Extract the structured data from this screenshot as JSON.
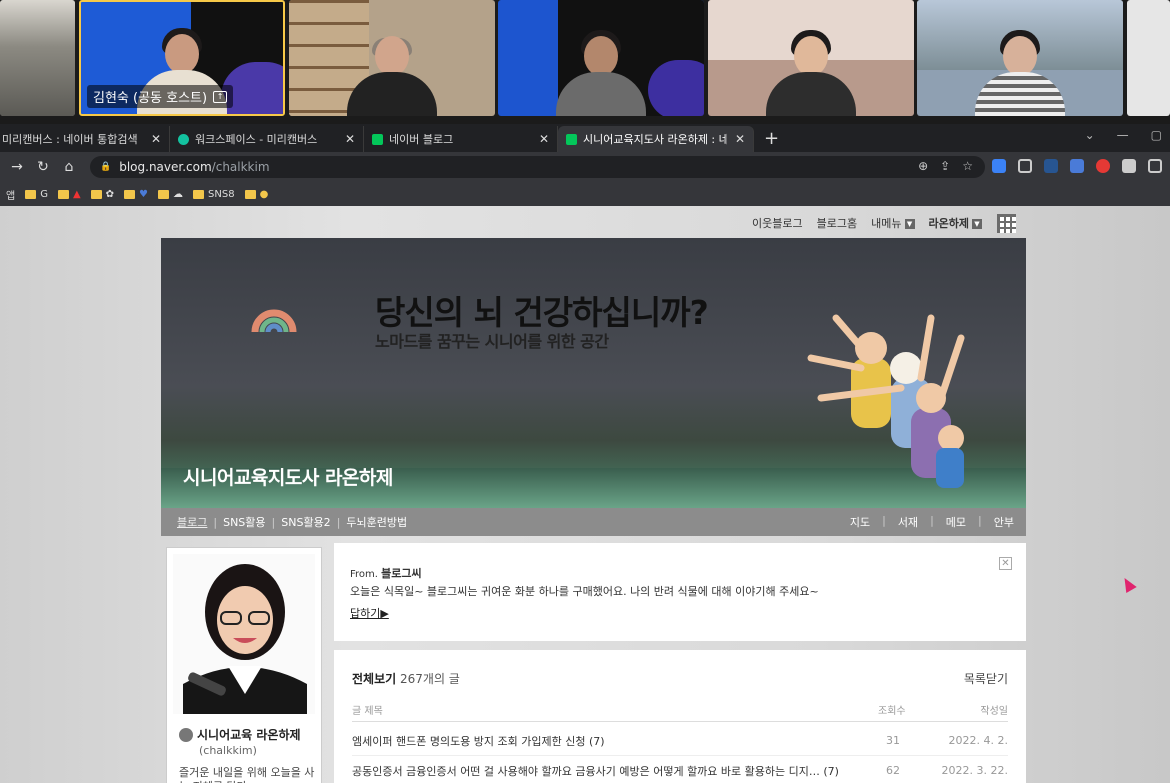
{
  "video_call": {
    "tiles": [
      {
        "name": "",
        "bg": "#8b8a86"
      },
      {
        "name": "김현숙 (공동 호스트)",
        "bg": "#1e5bd6",
        "active": true
      },
      {
        "name": "",
        "bg": "#b4a28a"
      },
      {
        "name": "",
        "bg": "#1d55cf"
      },
      {
        "name": "",
        "bg": "#b89a8c"
      },
      {
        "name": "",
        "bg": "#8fa0b2"
      },
      {
        "name": "",
        "bg": "#e6e6e6"
      }
    ],
    "host_label": "김현숙 (공동 호스트)"
  },
  "browser": {
    "tabs": [
      {
        "title": "미리캔버스 : 네이버 통합검색",
        "fav_color": "#03c75a",
        "active": false
      },
      {
        "title": "워크스페이스 - 미리캔버스",
        "fav_color": "#13c2a0",
        "active": false
      },
      {
        "title": "네이버 블로그",
        "fav_color": "#03c75a",
        "active": false
      },
      {
        "title": "시니어교육지도사 라온하제 : 네",
        "fav_color": "#03c75a",
        "active": true
      }
    ],
    "new_tab": "+",
    "url_host": "blog.naver.com",
    "url_path": "/chalkkim",
    "bookmarks": [
      {
        "label": "앱",
        "folder": false
      },
      {
        "label": "G",
        "folder": true
      },
      {
        "label": "",
        "folder": true
      },
      {
        "label": "",
        "folder": true
      },
      {
        "label": "",
        "folder": true
      },
      {
        "label": "",
        "folder": true
      },
      {
        "label": "SNS8",
        "folder": true
      },
      {
        "label": "",
        "folder": true
      }
    ]
  },
  "blog": {
    "top_menu": {
      "neighbor": "이웃블로그",
      "home": "블로그홈",
      "mymenu": "내메뉴",
      "user": "라온하제"
    },
    "banner": {
      "headline": "당신의 뇌 건강하십니까?",
      "sub": "노마드를 꿈꾸는 시니어를 위한 공간",
      "title": "시니어교육지도사 라온하제"
    },
    "nav": {
      "left": [
        "블로그",
        "SNS활용",
        "SNS활용2",
        "두뇌훈련방법"
      ],
      "right": [
        "지도",
        "서재",
        "메모",
        "안부"
      ]
    },
    "profile": {
      "nickname": "시니어교육 라온하제",
      "id": "(chalkkim)",
      "desc": "즐거운 내일을 위해 오늘을 사는 지혜를 담다"
    },
    "notice": {
      "from_prefix": "From.",
      "from_name": "블로그씨",
      "message": "오늘은 식목일~ 블로그씨는 귀여운 화분 하나를 구매했어요. 나의 반려 식물에 대해 이야기해 주세요~",
      "reply": "답하기▶"
    },
    "posts": {
      "header": "전체보기",
      "count": "267개의 글",
      "close_list": "목록닫기",
      "col_title": "글 제목",
      "col_views": "조회수",
      "col_date": "작성일",
      "rows": [
        {
          "title": "엠세이퍼 핸드폰 명의도용 방지 조회 가입제한 신청 (7)",
          "views": "31",
          "date": "2022. 4. 2."
        },
        {
          "title": "공동인증서 금융인증서 어떤 걸 사용해야 할까요 금융사기 예방은 어떻게 할까요 바로 활용하는 디지…   (7)",
          "views": "62",
          "date": "2022. 3. 22."
        }
      ]
    }
  }
}
